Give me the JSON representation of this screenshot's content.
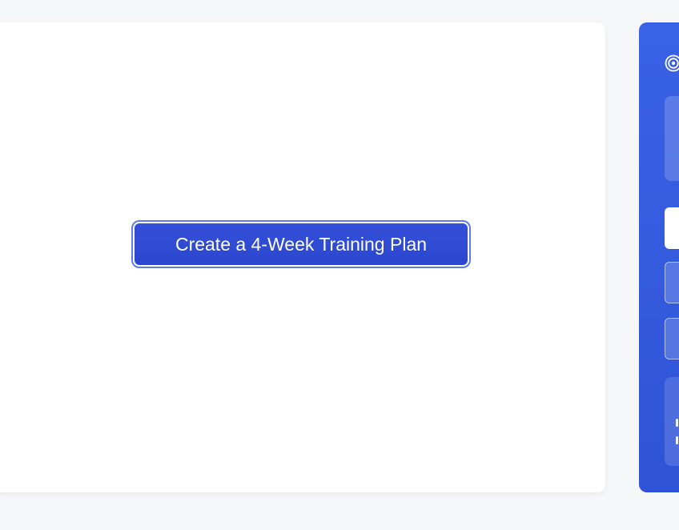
{
  "main": {
    "cta_label": "Create a 4-Week Training Plan"
  },
  "side_panel": {
    "icon": "target-icon",
    "colors": {
      "panel": "#3a62e6",
      "button": "#2c47cf"
    }
  }
}
